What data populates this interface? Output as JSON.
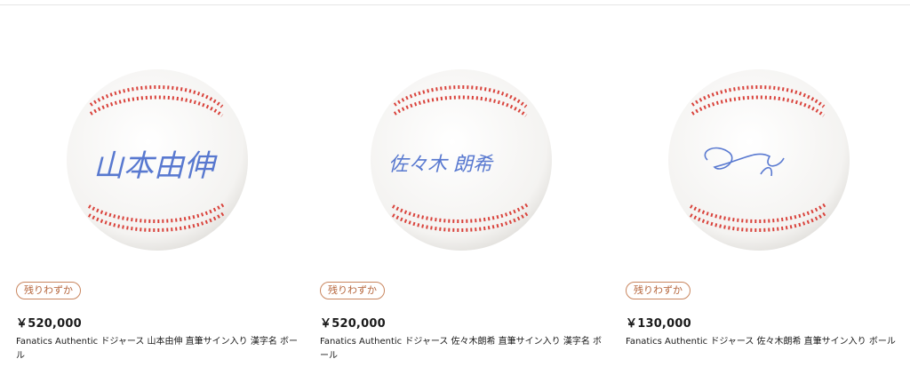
{
  "products": [
    {
      "image_alt": "山本由伸",
      "badge": "残りわずか",
      "price": "￥520,000",
      "title": "Fanatics Authentic ドジャース 山本由伸 直筆サイン入り 漢字名 ボール"
    },
    {
      "image_alt": "佐々木 朗希",
      "badge": "残りわずか",
      "price": "￥520,000",
      "title": "Fanatics Authentic ドジャース 佐々木朗希 直筆サイン入り 漢字名 ボール"
    },
    {
      "image_alt": "",
      "badge": "残りわずか",
      "price": "￥130,000",
      "title": "Fanatics Authentic ドジャース 佐々木朗希 直筆サイン入り ボール"
    }
  ],
  "colors": {
    "stitch": "#d9423b",
    "signature": "#3d63c9",
    "badge_border": "#c9865f",
    "badge_text": "#b5653b"
  }
}
